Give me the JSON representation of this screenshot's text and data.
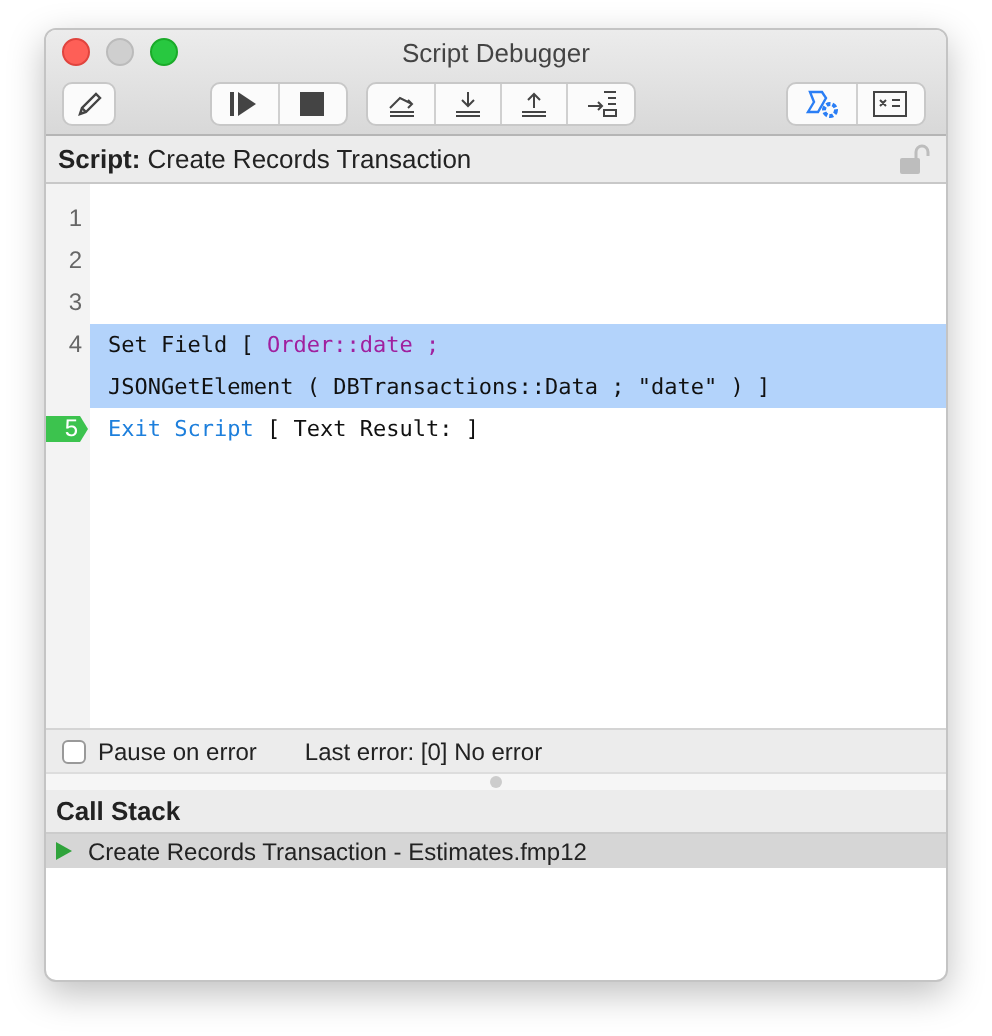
{
  "window": {
    "title": "Script Debugger"
  },
  "script": {
    "label": "Script:",
    "name": "Create Records Transaction",
    "locked": false
  },
  "lines": [
    {
      "number": "1",
      "selected": false,
      "current": false
    },
    {
      "number": "2",
      "selected": false,
      "current": false
    },
    {
      "number": "3",
      "selected": false,
      "current": false
    },
    {
      "number": "4",
      "selected": true,
      "current": false,
      "rows": [
        [
          {
            "kind": "plain",
            "text": "Set Field [ "
          },
          {
            "kind": "field",
            "text": "Order::date ;"
          }
        ],
        [
          {
            "kind": "plain",
            "text": "JSONGetElement ( DBTransactions::Data ; \"date\" ) ]"
          }
        ]
      ]
    },
    {
      "number": "5",
      "selected": false,
      "current": true,
      "rows": [
        [
          {
            "kind": "step",
            "text": "Exit Script"
          },
          {
            "kind": "plain",
            "text": " [ Text Result: ]"
          }
        ]
      ]
    }
  ],
  "status": {
    "pause_label": "Pause on error",
    "pause_checked": false,
    "last_error": "Last error: [0] No error"
  },
  "call_stack": {
    "title": "Call Stack",
    "items": [
      {
        "text": "Create Records Transaction - Estimates.fmp12",
        "selected": true
      }
    ]
  }
}
